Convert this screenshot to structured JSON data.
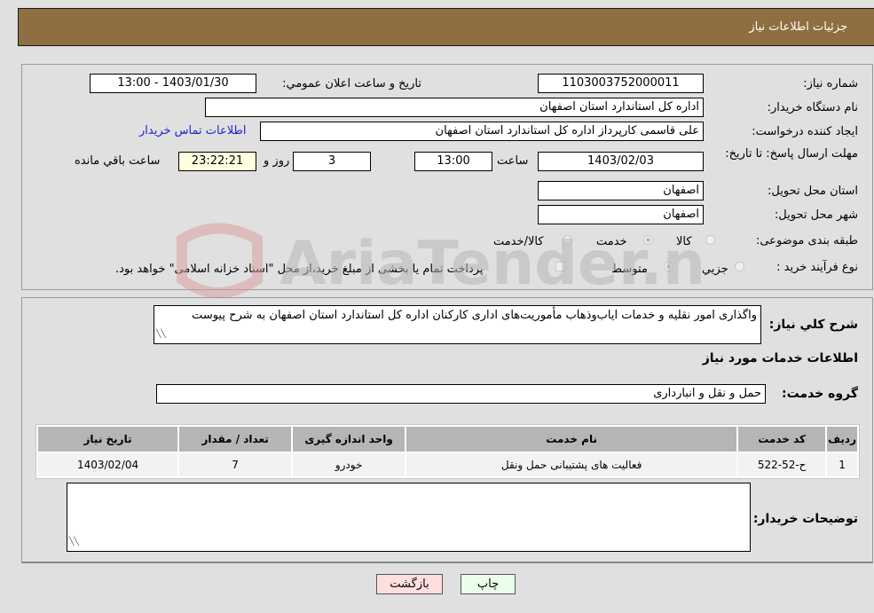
{
  "header": {
    "title": "جزئيات اطلاعات نياز"
  },
  "form": {
    "need_number": {
      "label": "شماره نياز:",
      "value": "1103003752000011"
    },
    "announce_datetime": {
      "label": "تاريخ و ساعت اعلان عمومي:",
      "value": "1403/01/30 - 13:00"
    },
    "buyer_org": {
      "label": "نام دستگاه خريدار:",
      "value": "اداره کل استاندارد استان اصفهان"
    },
    "requester": {
      "label": "ايجاد کننده درخواست:",
      "value": "علی قاسمی کارپرداز اداره کل استاندارد استان اصفهان"
    },
    "buyer_contact_link": "اطلاعات تماس خريدار",
    "deadline": {
      "label": "مهلت ارسال پاسخ: تا تاريخ:",
      "date": "1403/02/03",
      "time_label": "ساعت",
      "time": "13:00",
      "days": "3",
      "days_label": "روز و",
      "remaining": "23:22:21",
      "remaining_label": "ساعت باقي مانده"
    },
    "delivery_province": {
      "label": "استان محل تحویل:",
      "value": "اصفهان"
    },
    "delivery_city": {
      "label": "شهر محل تحویل:",
      "value": "اصفهان"
    },
    "category": {
      "label": "طبقه بندی موضوعی:",
      "options": [
        "کالا",
        "خدمت",
        "کالا/خدمت"
      ],
      "selected": "خدمت"
    },
    "purchase_type": {
      "label": "نوع فرآيند خريد :",
      "options": [
        "جزيي",
        "متوسط"
      ],
      "selected": "متوسط",
      "treasury_note": "پرداخت تمام يا بخشی از مبلغ خريد،از محل \"اسناد خزانه اسلامی\" خواهد بود."
    }
  },
  "description": {
    "label": "شرح کلي نياز:",
    "value": "واگذاری امور نقليه و خدمات اياب‌وذهاب مأموريت‌های اداری کارکنان اداره کل استاندارد استان اصفهان به شرح پيوست"
  },
  "services_section": {
    "title": "اطلاعات خدمات مورد نياز",
    "group_label": "گروه خدمت:",
    "group_value": "حمل و نقل و انبارداری"
  },
  "table": {
    "columns": [
      "رديف",
      "کد خدمت",
      "نام خدمت",
      "واحد اندازه گيری",
      "تعداد / مقدار",
      "تاريخ نياز"
    ],
    "rows": [
      [
        "1",
        "ح-52-522",
        "فعاليت های پشتيبانی حمل ونقل",
        "خودرو",
        "7",
        "1403/02/04"
      ]
    ]
  },
  "buyer_notes": {
    "label": "توضيحات خريدار:",
    "value": ""
  },
  "buttons": {
    "print": "چاپ",
    "back": "بازگشت"
  },
  "colors": {
    "header_bg": "#8f6f42",
    "print_bg": "#eaffea",
    "back_bg": "#ffdede",
    "link": "#2222cc"
  }
}
